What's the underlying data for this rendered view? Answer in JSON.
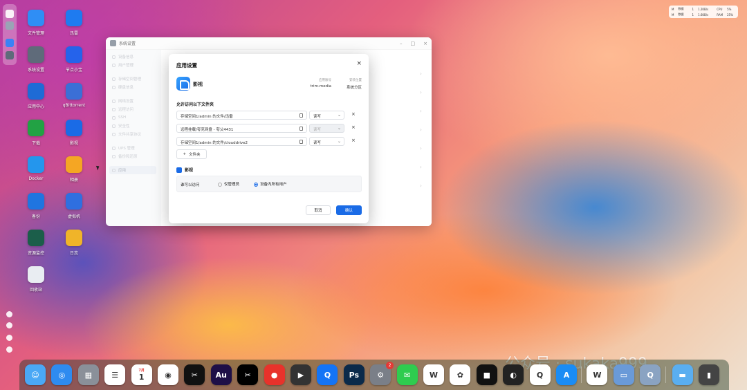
{
  "desktop": {
    "icons": [
      {
        "label": "文件管理",
        "icon": "folder-icon",
        "color": "#2f8ef5"
      },
      {
        "label": "迅雷",
        "icon": "thunder-icon",
        "color": "#1e7bf0"
      },
      {
        "label": "系统设置",
        "icon": "gear-icon",
        "color": "#5f6b7a"
      },
      {
        "label": "节点小宝",
        "icon": "node-icon",
        "color": "#2563eb"
      },
      {
        "label": "应用中心",
        "icon": "store-icon",
        "color": "#1e6bd6"
      },
      {
        "label": "qBittorrent",
        "icon": "qbittorrent-icon",
        "color": "#3b6fd6"
      },
      {
        "label": "下载",
        "icon": "download-icon",
        "color": "#22a244"
      },
      {
        "label": "影视",
        "icon": "media-icon",
        "color": "#1a6be6"
      },
      {
        "label": "Docker",
        "icon": "docker-icon",
        "color": "#2496ed"
      },
      {
        "label": "相册",
        "icon": "photos-icon",
        "color": "#f5a623"
      },
      {
        "label": "备份",
        "icon": "backup-icon",
        "color": "#1f75e0"
      },
      {
        "label": "虚拟机",
        "icon": "vm-icon",
        "color": "#2f6fe0"
      },
      {
        "label": "资源监控",
        "icon": "monitor-icon",
        "color": "#1b5e4a"
      },
      {
        "label": "日志",
        "icon": "log-icon",
        "color": "#f0b429"
      },
      {
        "label": "回收站",
        "icon": "trash-icon",
        "color": "#e9edf2"
      }
    ]
  },
  "status_widget": {
    "rows": [
      [
        "M",
        "数据",
        "1",
        "1.2KB/s",
        "CPU",
        "5%"
      ],
      [
        "M",
        "数据",
        "1",
        "1.6KB/s",
        "RAM",
        "25%"
      ]
    ]
  },
  "settings_window": {
    "title": "系统设置",
    "sidebar": [
      "设备信息",
      "用户管理",
      "",
      "存储空间管理",
      "硬盘信息",
      "",
      "网络设置",
      "远程访问",
      "SSH",
      "安全性",
      "文件共享协议",
      "",
      "UPS 管理",
      "备份和还原",
      "",
      "应用"
    ],
    "active_item": "应用"
  },
  "dialog": {
    "title": "应用设置",
    "close": "×",
    "app": {
      "name": "影视",
      "id_label": "应用账号",
      "id_value": "trim-media",
      "location_label": "安装位置",
      "location_value": "系统分区"
    },
    "folders_title": "允许访问以下文件夹",
    "folders": [
      {
        "path": "存储空间1/admin 的文件/迅雷",
        "permission": "读写",
        "disabled": false
      },
      {
        "path": "远程挂载/夸克网盘 - 夸父4431",
        "permission": "读写",
        "disabled": true
      },
      {
        "path": "存储空间1/admin 的文件/clouddrive2",
        "permission": "读写",
        "disabled": false
      }
    ],
    "add_folder": "文件夹",
    "perm_section_title": "影视",
    "perm_label": "谁可以访问",
    "perm_options": [
      "仅管理员",
      "设备内所有用户"
    ],
    "perm_selected": "设备内所有用户",
    "cancel": "取消",
    "confirm": "确认"
  },
  "dock": {
    "items": [
      {
        "name": "finder",
        "glyph": "☺",
        "color": "#4aa8f5"
      },
      {
        "name": "safari",
        "glyph": "◎",
        "color": "#2e8bf0"
      },
      {
        "name": "launchpad",
        "glyph": "▦",
        "color": "#8a9099"
      },
      {
        "name": "reminders",
        "glyph": "☰",
        "color": "#ffffff"
      },
      {
        "name": "calendar",
        "glyph": "1",
        "color": "#ffffff",
        "sub": "7月"
      },
      {
        "name": "chrome",
        "glyph": "◉",
        "color": "#ffffff"
      },
      {
        "name": "capcut",
        "glyph": "✂",
        "color": "#111111"
      },
      {
        "name": "audition",
        "glyph": "Au",
        "color": "#1e0f47"
      },
      {
        "name": "capcut-alt",
        "glyph": "✂",
        "color": "#000000"
      },
      {
        "name": "red-app",
        "glyph": "●",
        "color": "#e8322b"
      },
      {
        "name": "final-cut",
        "glyph": "▶",
        "color": "#333333"
      },
      {
        "name": "quik",
        "glyph": "Q",
        "color": "#1474f6"
      },
      {
        "name": "photoshop",
        "glyph": "Ps",
        "color": "#0b2a4a"
      },
      {
        "name": "settings",
        "glyph": "⚙",
        "color": "#7a7f88",
        "badge": "2"
      },
      {
        "name": "wechat",
        "glyph": "✉",
        "color": "#2ecc4f"
      },
      {
        "name": "wps",
        "glyph": "W",
        "color": "#ffffff"
      },
      {
        "name": "chatgpt",
        "glyph": "✿",
        "color": "#ffffff"
      },
      {
        "name": "recorder",
        "glyph": "■",
        "color": "#111111"
      },
      {
        "name": "obs",
        "glyph": "◐",
        "color": "#222222"
      },
      {
        "name": "qq",
        "glyph": "Q",
        "color": "#ffffff"
      },
      {
        "name": "app-store",
        "glyph": "A",
        "color": "#1a8cf4"
      },
      {
        "name": "wps-2",
        "glyph": "W",
        "color": "#ffffff"
      },
      {
        "name": "preview",
        "glyph": "▭",
        "color": "#6a9ad8"
      },
      {
        "name": "quicktime",
        "glyph": "Q",
        "color": "#8aa3c2"
      },
      {
        "name": "folder",
        "glyph": "▬",
        "color": "#5aaef0"
      },
      {
        "name": "trash",
        "glyph": "▮",
        "color": "#444444"
      }
    ]
  },
  "watermark": "公众号 · sukaka999"
}
